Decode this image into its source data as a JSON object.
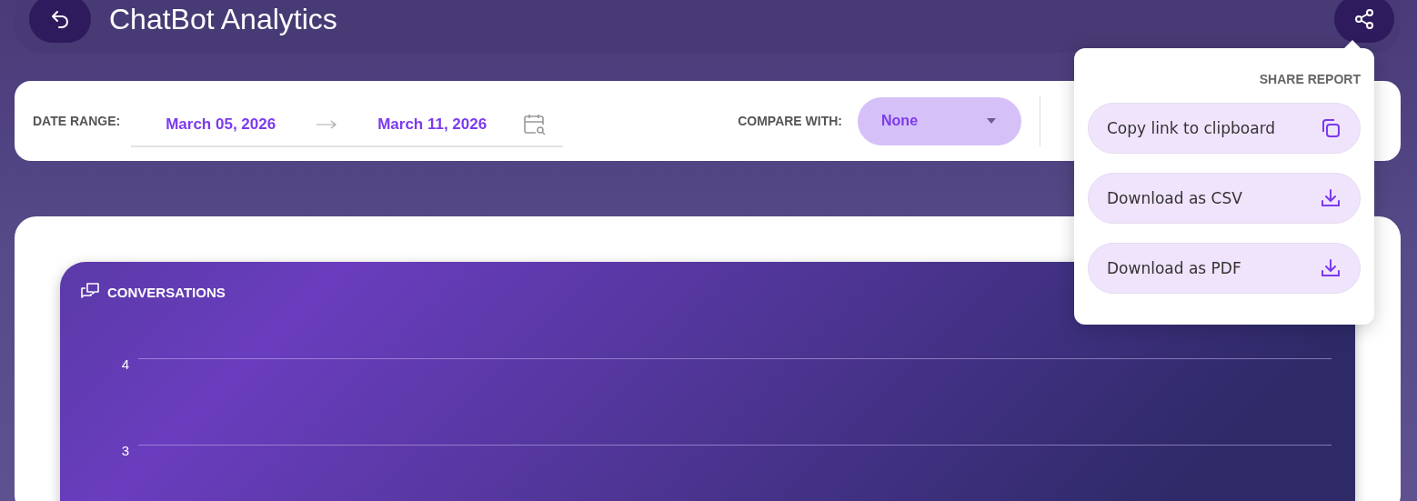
{
  "header": {
    "title": "ChatBot Analytics"
  },
  "filters": {
    "date_range_label": "DATE RANGE:",
    "start_date": "March 05, 2026",
    "end_date": "March 11, 2026",
    "compare_label": "COMPARE WITH:",
    "compare_value": "None"
  },
  "share_menu": {
    "title": "SHARE REPORT",
    "items": [
      {
        "label": "Copy link to clipboard",
        "kind": "copy"
      },
      {
        "label": "Download as CSV",
        "kind": "download"
      },
      {
        "label": "Download as PDF",
        "kind": "download"
      }
    ]
  },
  "conversations_card": {
    "title": "CONVERSATIONS",
    "y_axis_labels": [
      "4",
      "3"
    ]
  }
}
